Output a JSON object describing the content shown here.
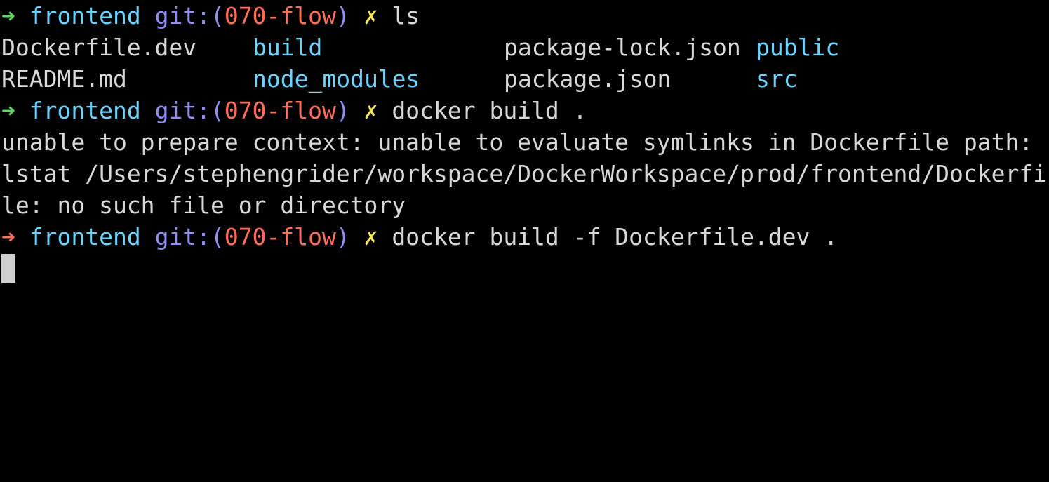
{
  "prompt": {
    "arrow": "➜",
    "dir": "frontend",
    "git_prefix": "git:(",
    "branch": "070-flow",
    "git_suffix": ")",
    "dirty": "✗"
  },
  "commands": [
    "ls",
    "docker build .",
    "docker build -f Dockerfile.dev ."
  ],
  "ls_output": {
    "rows": [
      [
        {
          "name": "Dockerfile.dev",
          "kind": "file"
        },
        {
          "name": "build",
          "kind": "folder"
        },
        {
          "name": "package-lock.json",
          "kind": "file"
        },
        {
          "name": "public",
          "kind": "folder"
        }
      ],
      [
        {
          "name": "README.md",
          "kind": "file"
        },
        {
          "name": "node_modules",
          "kind": "folder"
        },
        {
          "name": "package.json",
          "kind": "file"
        },
        {
          "name": "src",
          "kind": "folder"
        }
      ]
    ]
  },
  "error_lines": [
    "unable to prepare context: unable to evaluate symlinks in Dockerfile path:",
    "lstat /Users/stephengrider/workspace/DockerWorkspace/prod/frontend/Dockerfi",
    "le: no such file or directory"
  ],
  "colors": {
    "background": "#000000",
    "text": "#d8d8d8",
    "arrow_success": "#5fd75f",
    "arrow_error": "#ff6e57",
    "dir": "#6bd5ff",
    "git": "#8f8ff5",
    "branch": "#ff6e57",
    "dirty": "#f7e659",
    "cursor": "#cfcfcf"
  }
}
